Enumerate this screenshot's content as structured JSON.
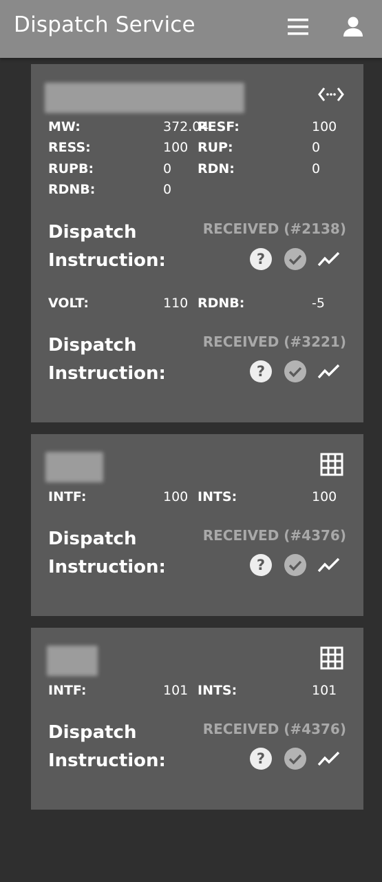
{
  "header": {
    "title": "Dispatch Service",
    "menu_icon": "hamburger-menu-icon",
    "user_icon": "account-icon"
  },
  "cards": [
    {
      "header_icon": "code-arrows-icon",
      "fields": [
        {
          "label": "MW:",
          "value": "372.04"
        },
        {
          "label": "RESF:",
          "value": "100"
        },
        {
          "label": "RESS:",
          "value": "100"
        },
        {
          "label": "RUP:",
          "value": "0"
        },
        {
          "label": "RUPB:",
          "value": "0"
        },
        {
          "label": "RDN:",
          "value": "0"
        },
        {
          "label": "RDNB:",
          "value": "0"
        }
      ],
      "instructions": [
        {
          "title": "Dispatch Instruction:",
          "status": "RECEIVED (#2138)"
        },
        {
          "title": "Dispatch Instruction:",
          "status": "RECEIVED (#3221)"
        }
      ],
      "extra_fields": [
        {
          "label": "VOLT:",
          "value": "110"
        },
        {
          "label": "RDNB:",
          "value": "-5"
        }
      ]
    },
    {
      "header_icon": "grid-icon",
      "fields": [
        {
          "label": "INTF:",
          "value": "100"
        },
        {
          "label": "INTS:",
          "value": "100"
        }
      ],
      "instructions": [
        {
          "title": "Dispatch Instruction:",
          "status": "RECEIVED (#4376)"
        }
      ]
    },
    {
      "header_icon": "grid-icon",
      "fields": [
        {
          "label": "INTF:",
          "value": "101"
        },
        {
          "label": "INTS:",
          "value": "101"
        }
      ],
      "instructions": [
        {
          "title": "Dispatch Instruction:",
          "status": "RECEIVED (#4376)"
        }
      ]
    }
  ],
  "action_icons": [
    "help-circle-icon",
    "check-circle-icon",
    "trend-line-icon"
  ],
  "colors": {
    "background": "#2f2f2f",
    "appbar": "#8a8a8a",
    "card": "#5a5a5a",
    "status_text": "#a9a9a9",
    "icon_light": "#eeeeee",
    "icon_muted": "#b3b3b3"
  }
}
